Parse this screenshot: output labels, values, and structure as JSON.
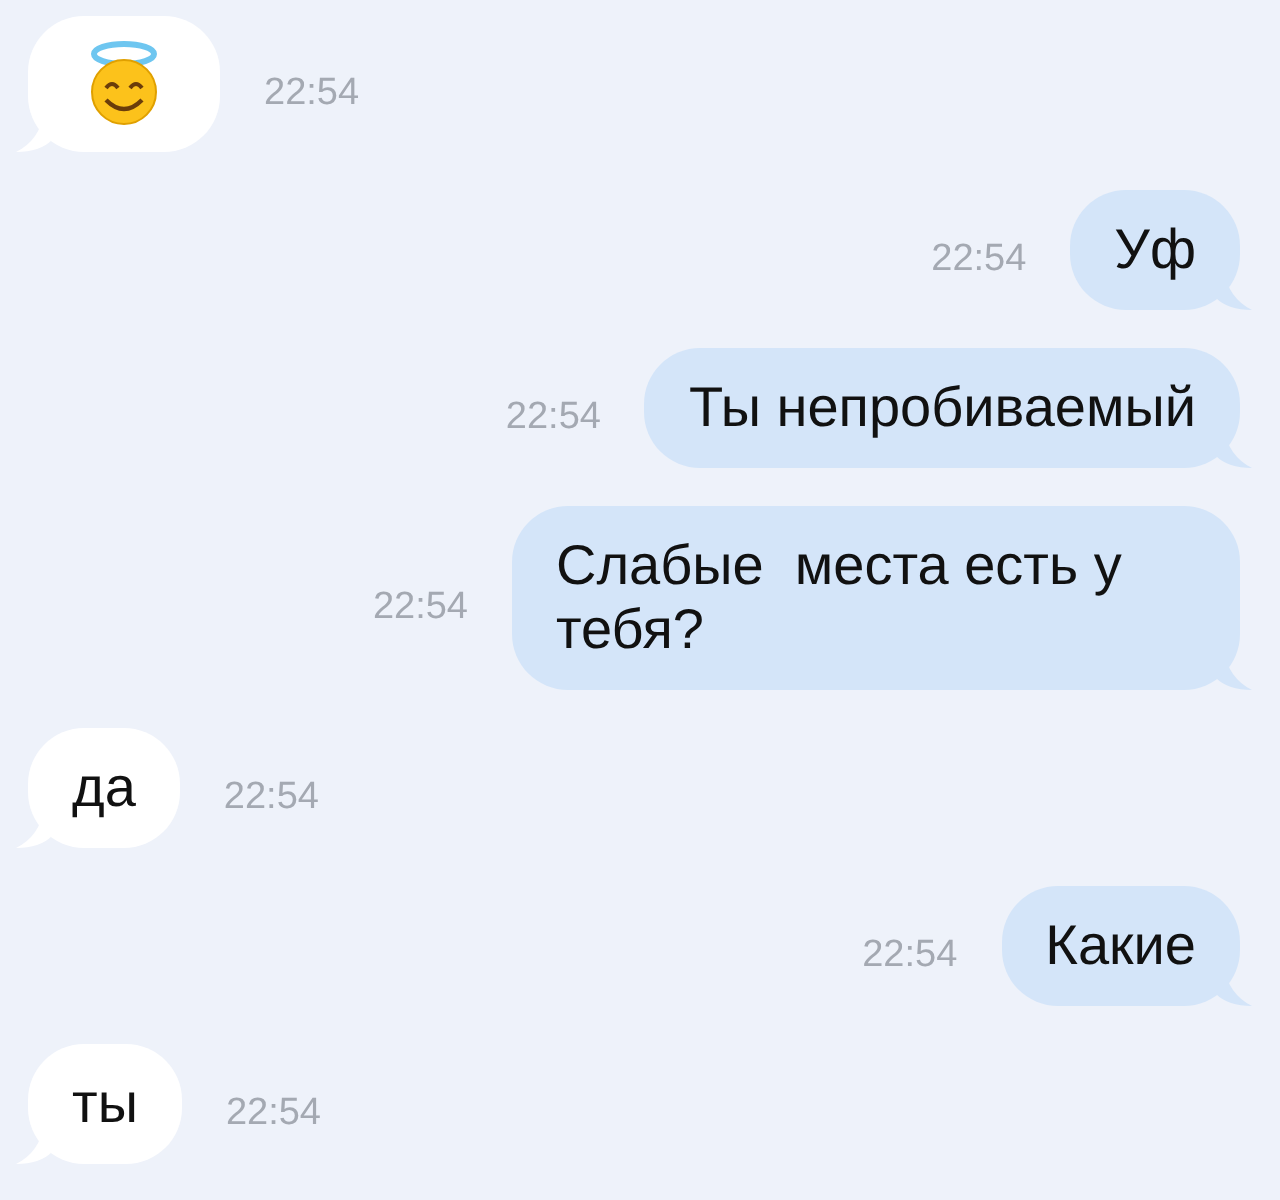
{
  "messages": [
    {
      "kind": "emoji",
      "outgoing": false,
      "time": "22:54"
    },
    {
      "kind": "text",
      "outgoing": true,
      "text": "Уф",
      "time": "22:54"
    },
    {
      "kind": "text",
      "outgoing": true,
      "text": "Ты непробиваемый",
      "time": "22:54"
    },
    {
      "kind": "text",
      "outgoing": true,
      "text": "Слабые  места есть у тебя?",
      "time": "22:54"
    },
    {
      "kind": "text",
      "outgoing": false,
      "text": "да",
      "time": "22:54"
    },
    {
      "kind": "text",
      "outgoing": true,
      "text": "Какие",
      "time": "22:54"
    },
    {
      "kind": "text",
      "outgoing": false,
      "text": "ты",
      "time": "22:54"
    }
  ]
}
